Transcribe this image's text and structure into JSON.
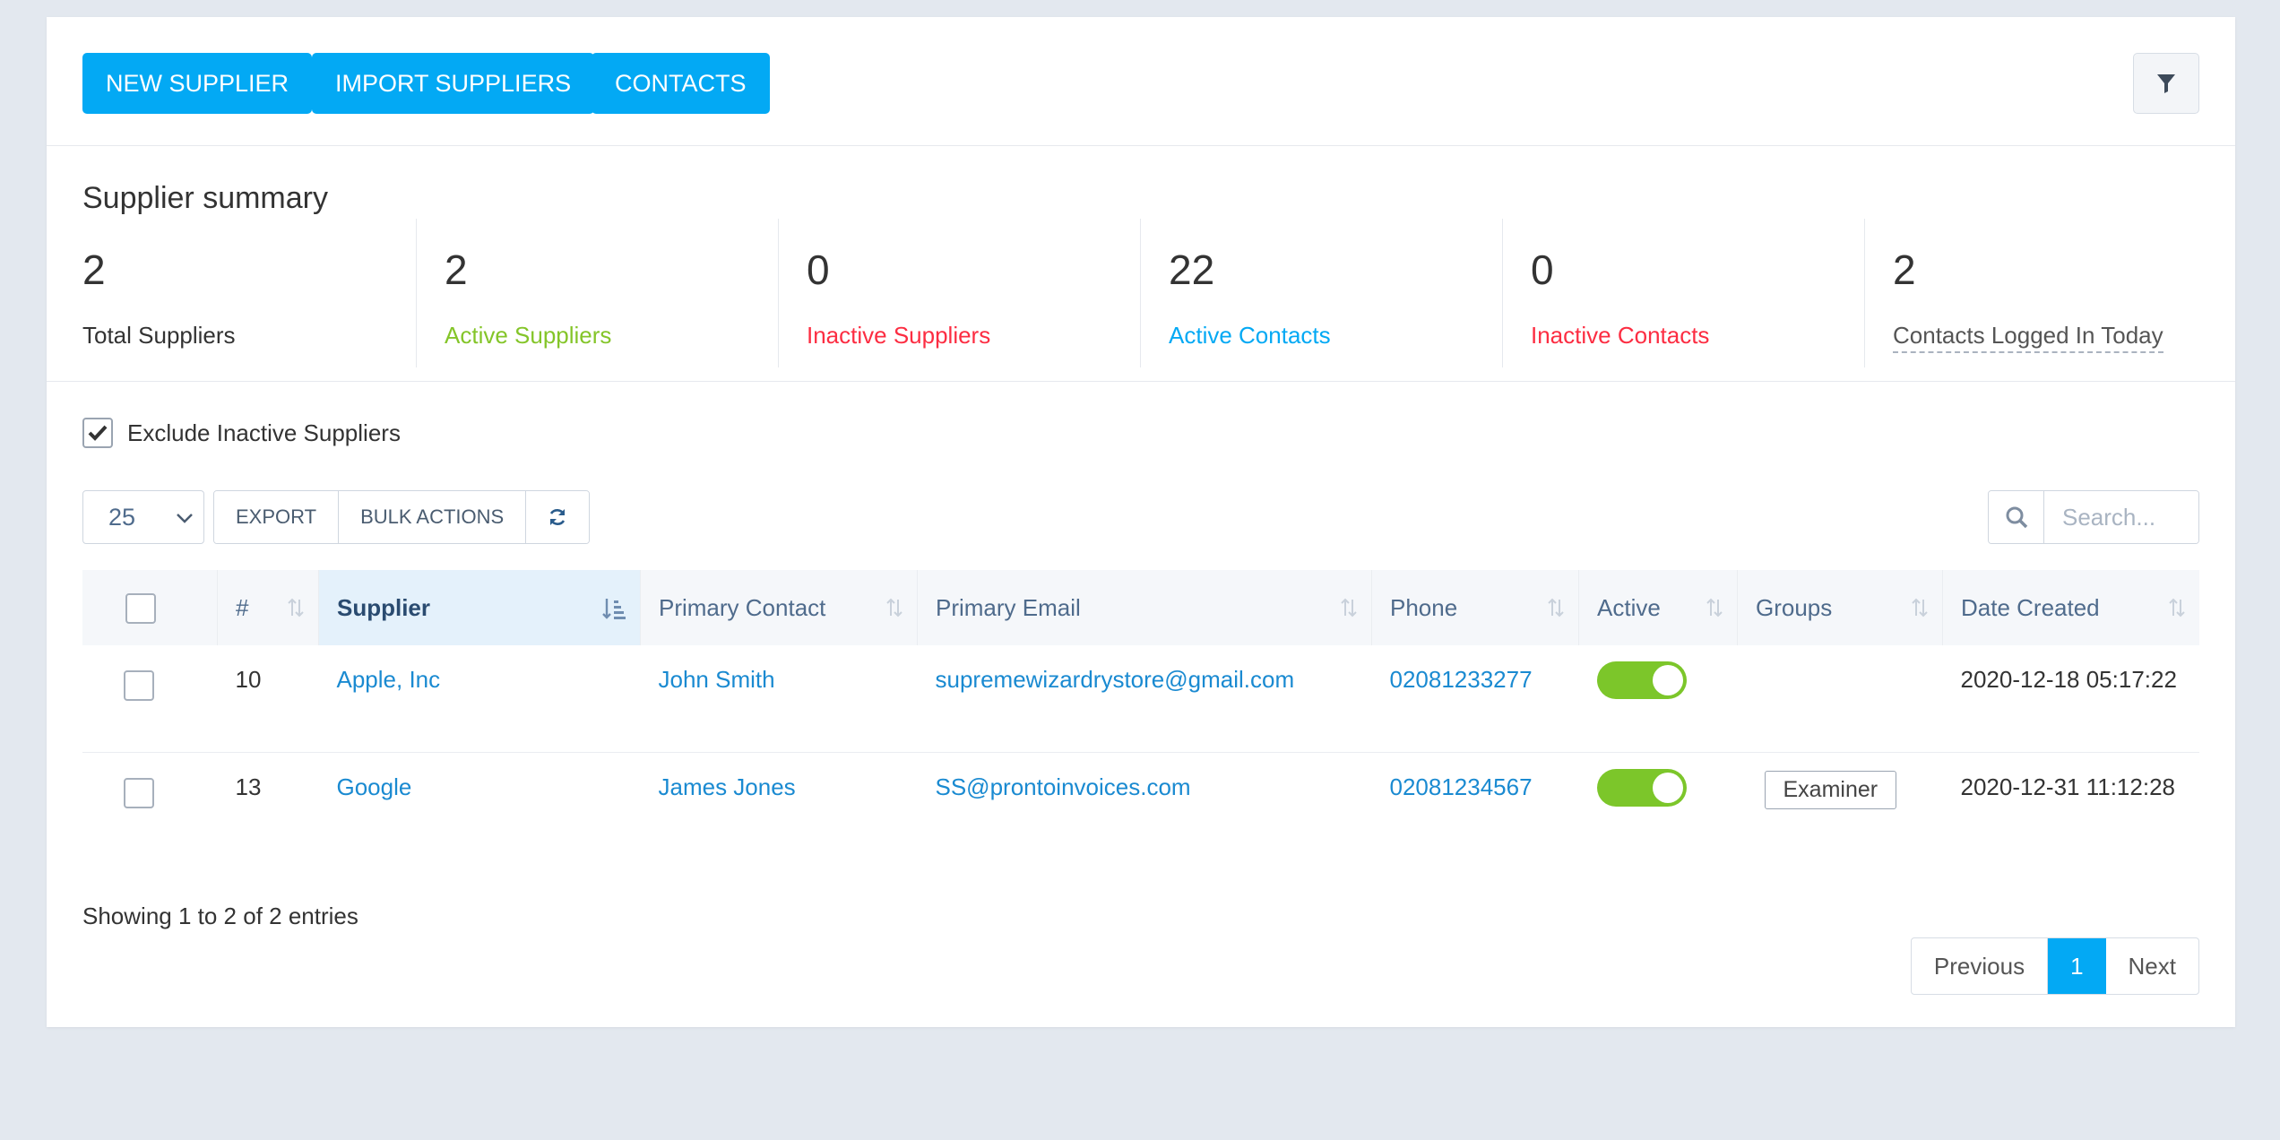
{
  "toolbar": {
    "new_supplier": "NEW SUPPLIER",
    "import_suppliers": "IMPORT SUPPLIERS",
    "contacts": "CONTACTS",
    "filter_icon": "filter-icon"
  },
  "summary": {
    "title": "Supplier summary",
    "stats": [
      {
        "value": "2",
        "label": "Total Suppliers",
        "color": "#333333"
      },
      {
        "value": "2",
        "label": "Active Suppliers",
        "color": "#84c529"
      },
      {
        "value": "0",
        "label": "Inactive Suppliers",
        "color": "#fc2d42"
      },
      {
        "value": "22",
        "label": "Active Contacts",
        "color": "#03a9f4"
      },
      {
        "value": "0",
        "label": "Inactive Contacts",
        "color": "#fc2d42"
      },
      {
        "value": "2",
        "label": "Contacts Logged In Today",
        "color": "#555555"
      }
    ]
  },
  "filters": {
    "exclude_inactive_label": "Exclude Inactive Suppliers",
    "exclude_inactive_checked": true
  },
  "table_controls": {
    "page_length": "25",
    "export": "EXPORT",
    "bulk_actions": "BULK ACTIONS",
    "search_placeholder": "Search..."
  },
  "table": {
    "headers": [
      "#",
      "Supplier",
      "Primary Contact",
      "Primary Email",
      "Phone",
      "Active",
      "Groups",
      "Date Created"
    ],
    "rows": [
      {
        "id": "10",
        "supplier": "Apple, Inc",
        "contact": "John Smith",
        "email": "supremewizardrystore@gmail.com",
        "phone": "02081233277",
        "active": true,
        "group": "",
        "date": "2020-12-18 05:17:22"
      },
      {
        "id": "13",
        "supplier": "Google",
        "contact": "James Jones",
        "email": "SS@prontoinvoices.com",
        "phone": "02081234567",
        "active": true,
        "group": "Examiner",
        "date": "2020-12-31 11:12:28"
      }
    ]
  },
  "footer": {
    "info": "Showing 1 to 2 of 2 entries",
    "previous": "Previous",
    "current_page": "1",
    "next": "Next"
  },
  "colors": {
    "primary": "#03a9f4",
    "success": "#84c529",
    "danger": "#fc2d42",
    "link": "#1a8ad1"
  }
}
